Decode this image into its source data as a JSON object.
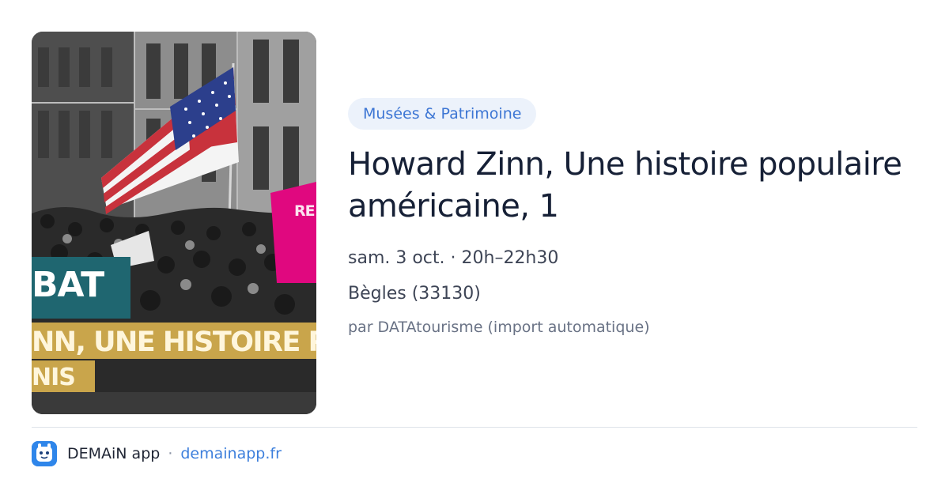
{
  "poster": {
    "text_bat": "BAT",
    "text_line1": "NN, UNE HISTOIRE PO",
    "text_line2": "NIS",
    "text_side": "RE PIR AV"
  },
  "event": {
    "category": "Musées & Patrimoine",
    "title": "Howard Zinn, Une histoire populaire américaine, 1",
    "date": "sam. 3 oct. · 20h–22h30",
    "location": "Bègles (33130)",
    "source": "par DATAtourisme (import automatique)"
  },
  "footer": {
    "app_name": "DEMAiN app",
    "separator": "·",
    "link": "demainapp.fr"
  },
  "colors": {
    "badge_bg": "#ecf2fb",
    "badge_text": "#3d76d4",
    "link": "#3d7fdc",
    "poster_teal": "#1f6670",
    "poster_gold": "#c9a54b",
    "poster_pink": "#e0087f"
  }
}
